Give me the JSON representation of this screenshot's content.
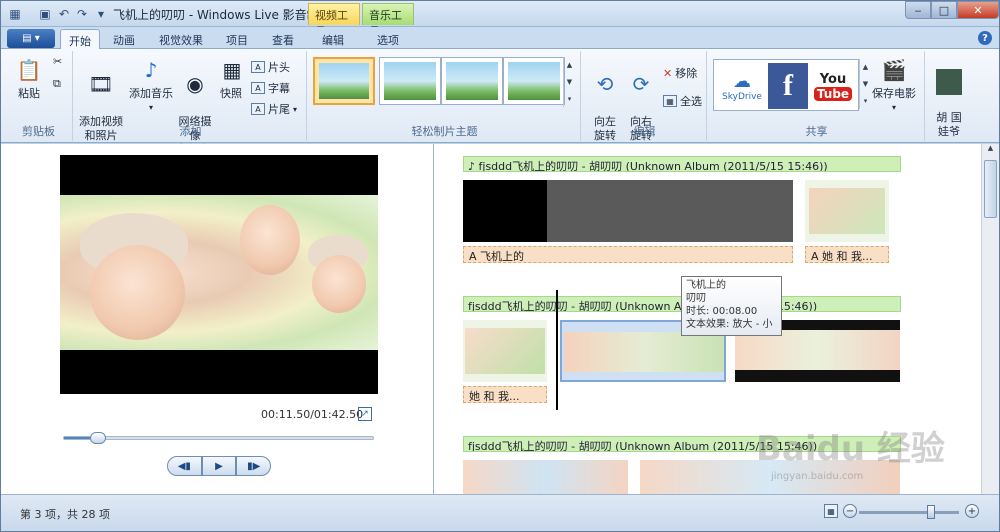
{
  "window": {
    "title": "飞机上的叨叨 - Windows Live 影音制作",
    "context_tabs": {
      "video": "视频工具",
      "music": "音乐工具"
    }
  },
  "ribbon_tabs": [
    "开始",
    "动画",
    "视觉效果",
    "项目",
    "查看",
    "编辑",
    "选项"
  ],
  "ribbon": {
    "clipboard": {
      "paste": "粘贴",
      "label": "剪贴板"
    },
    "add": {
      "add_video": "添加视频\n和照片",
      "add_music": "添加音乐",
      "webcam": "网络摄像\n机视频",
      "snapshot": "快照",
      "title": "片头",
      "caption": "字幕",
      "credits": "片尾",
      "label": "添加"
    },
    "themes": {
      "label": "轻松制片主题"
    },
    "editing": {
      "rotate_left": "向左\n旋转",
      "rotate_right": "向右\n旋转",
      "remove": "移除",
      "select_all": "全选",
      "label": "编辑"
    },
    "share": {
      "skydrive": "SkyDrive",
      "save_movie": "保存电影",
      "label": "共享"
    },
    "user": {
      "name": "胡 国\n娃爷"
    }
  },
  "preview": {
    "time": "00:11.50/01:42.50",
    "seek_fraction": 0.11
  },
  "storyboard": {
    "music_1": "♪ fjsddd飞机上的叨叨 - 胡叨叨 (Unknown Album (2011/5/15 15:46))",
    "music_2": "fjsddd飞机上的叨叨 - 胡叨叨 (Unknown Album (2011/5/15 15:46))",
    "music_3": "fjsddd飞机上的叨叨 - 胡叨叨 (Unknown Album (2011/5/15 15:46))",
    "caption_1": "A 飞机上的",
    "caption_2": "A 她 和 我...",
    "caption_3": "她 和 我...",
    "tooltip": {
      "line1": "飞机上的",
      "line2": "叨叨",
      "duration": "时长: 00:08.00",
      "effect": "文本效果: 放大 - 小"
    }
  },
  "status": {
    "text": "第 3 项，共 28 项"
  },
  "watermark": {
    "brand": "Baidu 经验",
    "url": "jingyan.baidu.com"
  }
}
